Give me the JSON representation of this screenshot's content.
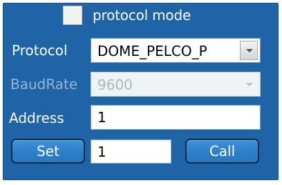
{
  "protocol_mode": {
    "label": "protocol mode",
    "checked": false
  },
  "protocol": {
    "label": "Protocol",
    "value": "DOME_PELCO_P",
    "enabled": true
  },
  "baudrate": {
    "label": "BaudRate",
    "value": "9600",
    "enabled": false
  },
  "address": {
    "label": "Address",
    "value": "1"
  },
  "preset": {
    "set_label": "Set",
    "value": "1",
    "call_label": "Call"
  },
  "colors": {
    "panel": "#1e64a6",
    "button": "#2d7fc7",
    "button_border": "#0d2a4a"
  }
}
